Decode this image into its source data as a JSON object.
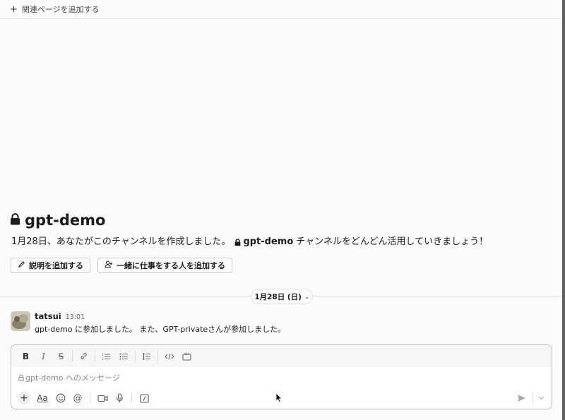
{
  "top": {
    "add_related_label": "関連ページを追加する"
  },
  "channel": {
    "name": "gpt-demo",
    "intro_prefix": "1月28日、あなたがこのチャンネルを作成しました。",
    "intro_suffix": "チャンネルをどんどん活用していきましょう！"
  },
  "actions": {
    "add_description": "説明を追加する",
    "add_people": "一緒に仕事をする人を追加する"
  },
  "date_divider": {
    "label": "1月28日 (日)"
  },
  "message": {
    "user": "tatsui",
    "time": "13:01",
    "text": "gpt-demo に参加しました。 また、GPT-privateさんが参加しました。"
  },
  "composer": {
    "placeholder": "gpt-demo へのメッセージ",
    "format_buttons": [
      "bold-icon",
      "italic-icon",
      "strikethrough-icon",
      "link-icon",
      "ordered-list-icon",
      "bulleted-list-icon",
      "blockquote-icon",
      "code-icon",
      "code-block-icon"
    ],
    "bottom_buttons": [
      "plus-icon",
      "text-format-icon",
      "emoji-icon",
      "mention-icon",
      "video-icon",
      "microphone-icon",
      "slash-command-icon",
      "send-icon"
    ]
  },
  "colors": {
    "background": "#fbfbfb",
    "text": "#1d1c1d",
    "border": "#b9b9b9",
    "edge": "#5f5f60"
  }
}
